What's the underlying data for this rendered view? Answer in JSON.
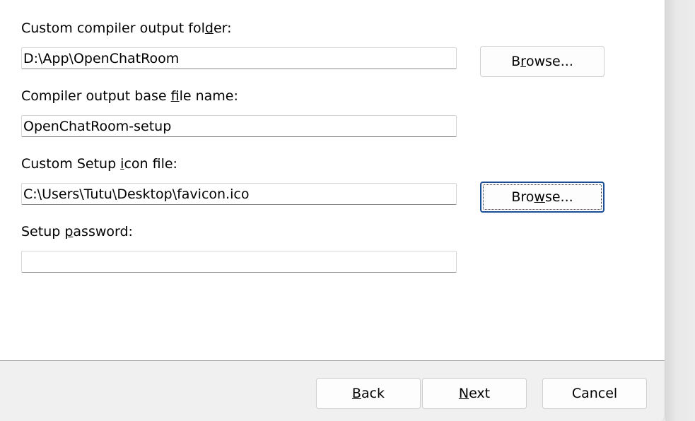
{
  "fields": {
    "output_folder": {
      "label_pre": "Custom compiler output fol",
      "label_mn": "d",
      "label_post": "er:",
      "value": "D:\\App\\OpenChatRoom",
      "browse_pre": "B",
      "browse_mn": "r",
      "browse_post": "owse..."
    },
    "base_file_name": {
      "label_pre": "Compiler output base ",
      "label_mn": "f",
      "label_post": "ile name:",
      "value": "OpenChatRoom-setup"
    },
    "icon_file": {
      "label_pre": "Custom Setup ",
      "label_mn": "i",
      "label_post": "con file:",
      "value": "C:\\Users\\Tutu\\Desktop\\favicon.ico",
      "browse_pre": "Bro",
      "browse_mn": "w",
      "browse_post": "se..."
    },
    "password": {
      "label_pre": "Setup ",
      "label_mn": "p",
      "label_post": "assword:",
      "value": ""
    }
  },
  "footer": {
    "back_mn": "B",
    "back_post": "ack",
    "next_mn": "N",
    "next_post": "ext",
    "cancel_label": "Cancel"
  },
  "colors": {
    "window_bg": "#ffffff",
    "footer_bg": "#f0f0f0",
    "focus_border": "#1a4f96"
  }
}
